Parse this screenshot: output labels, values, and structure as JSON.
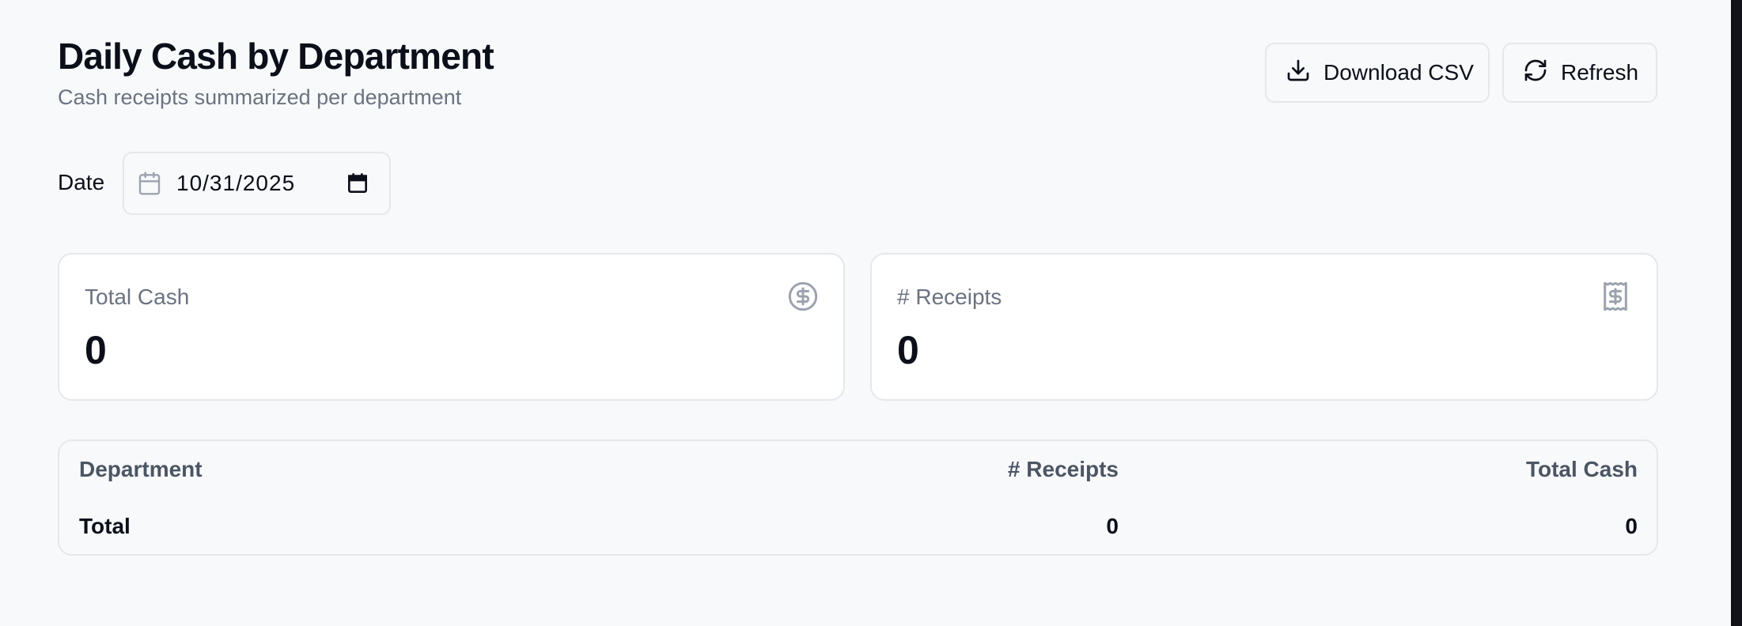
{
  "header": {
    "title": "Daily Cash by Department",
    "subtitle": "Cash receipts summarized per department"
  },
  "toolbar": {
    "download_label": "Download CSV",
    "download_icon": "download-icon",
    "refresh_label": "Refresh",
    "refresh_icon": "refresh-icon"
  },
  "filters": {
    "date_label": "Date",
    "date_value": "10/31/2025",
    "date_icon": "calendar-icon"
  },
  "stats": {
    "total_cash": {
      "label": "Total Cash",
      "value": "0",
      "icon": "dollar-circle-icon"
    },
    "receipts": {
      "label": "# Receipts",
      "value": "0",
      "icon": "receipt-icon"
    }
  },
  "table": {
    "columns": [
      "Department",
      "# Receipts",
      "Total Cash"
    ],
    "total_row": {
      "label": "Total",
      "receipts": "0",
      "total_cash": "0"
    }
  },
  "colors": {
    "background": "#f8f9fb",
    "text": "#0b0f19",
    "muted": "#6b7280",
    "border": "#e5e7eb"
  }
}
